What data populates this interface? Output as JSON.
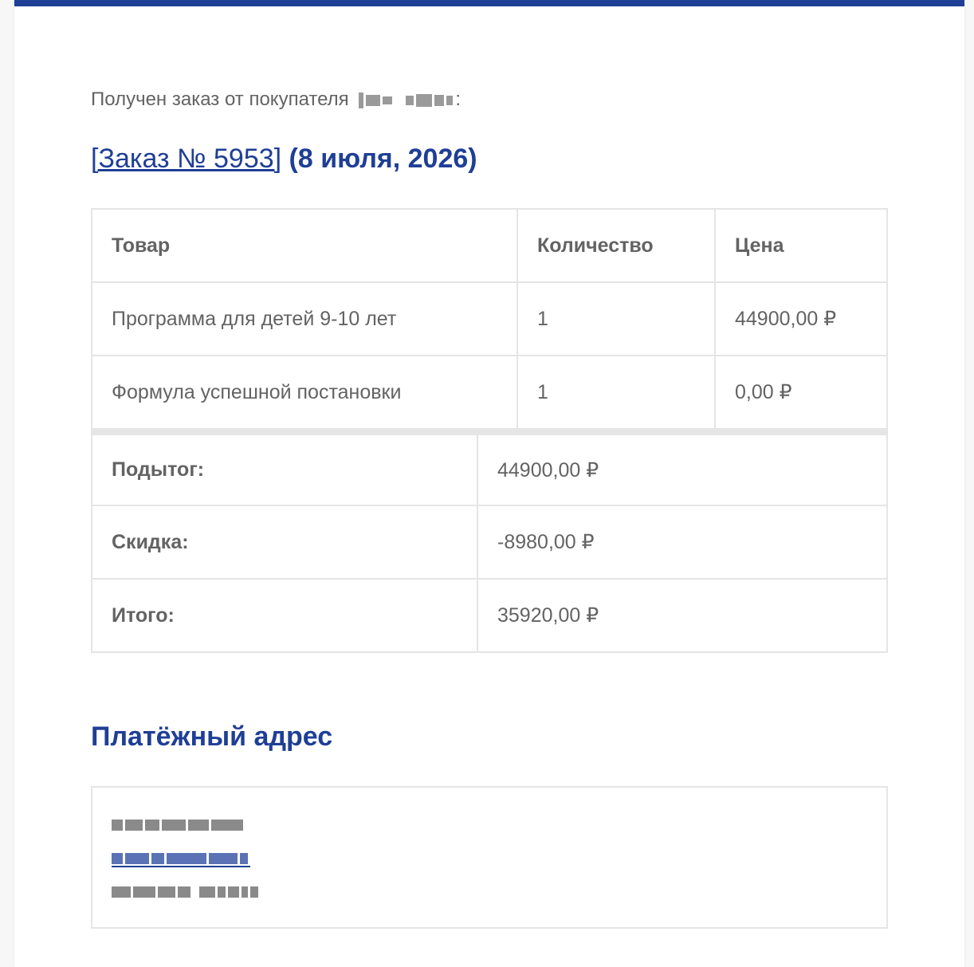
{
  "colors": {
    "brand": "#1f3f96",
    "text": "#636363",
    "border": "#e5e5e5"
  },
  "intro_text": "Получен заказ от покупателя",
  "order": {
    "link_text": "[Заказ № 5953]",
    "date_text": "(8 июля, 2026)"
  },
  "items_table": {
    "headers": [
      "Товар",
      "Количество",
      "Цена"
    ],
    "rows": [
      [
        "Программа для детей 9-10 лет",
        "1",
        "44900,00 ₽"
      ],
      [
        "Формула успешной постановки",
        "1",
        "0,00 ₽"
      ]
    ]
  },
  "totals": [
    {
      "label": "Подытог:",
      "value": "44900,00 ₽"
    },
    {
      "label": "Скидка:",
      "value": "-8980,00 ₽"
    },
    {
      "label": "Итого:",
      "value": "35920,00 ₽"
    }
  ],
  "billing": {
    "title": "Платёжный адрес"
  }
}
